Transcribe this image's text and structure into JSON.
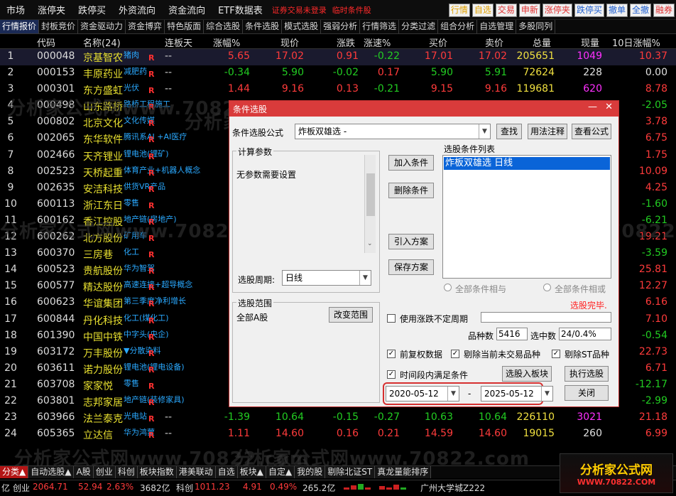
{
  "menu": {
    "items": [
      "市场",
      "涨停夹",
      "跌停买",
      "外资流向",
      "资金流向",
      "ETF数据表"
    ],
    "red_items": [
      "证券交易未登录",
      "临时条件股"
    ],
    "right_buttons": [
      {
        "label": "行情",
        "color": "#e0a000"
      },
      {
        "label": "自选",
        "color": "#e0a000"
      },
      {
        "label": "交易",
        "color": "#e03030"
      },
      {
        "label": "申新",
        "color": "#e03030"
      },
      {
        "label": "涨停夹",
        "color": "#e03030"
      },
      {
        "label": "跌停买",
        "color": "#2060d0"
      },
      {
        "label": "撤单",
        "color": "#2060d0"
      },
      {
        "label": "全撤",
        "color": "#2060d0"
      },
      {
        "label": "融券",
        "color": "#e03030"
      }
    ]
  },
  "tabs": [
    "行情报价",
    "封板竞价",
    "资金驱动力",
    "资金博弈",
    "特色版面",
    "综合选股",
    "条件选股",
    "模式选股",
    "强弱分析",
    "行情筛选",
    "分类过滤",
    "组合分析",
    "自选管理",
    "多股同列"
  ],
  "headers": {
    "idx": "",
    "code": "代码",
    "name": "名称(24)",
    "lbd": "连板天",
    "zdf": "涨幅%",
    "price": "现价",
    "zd": "涨跌",
    "zs": "涨速%",
    "buy": "买价",
    "sell": "卖价",
    "vol": "总量",
    "now": "现量",
    "zf10": "10日涨幅%"
  },
  "rows": [
    {
      "idx": "1",
      "code": "000048",
      "name": "京基智农",
      "tag": "猪肉",
      "lbd": "--",
      "zdf": "5.65",
      "price": "17.02",
      "zd": "0.91",
      "zs": "-0.22",
      "buy": "17.01",
      "sell": "17.02",
      "vol": "205651",
      "now": "1049",
      "zf10": "10.37"
    },
    {
      "idx": "2",
      "code": "000153",
      "name": "丰原药业",
      "tag": "减肥药",
      "lbd": "--",
      "zdf": "-0.34",
      "price": "5.90",
      "zd": "-0.02",
      "zs": "0.17",
      "buy": "5.90",
      "sell": "5.91",
      "vol": "72624",
      "now": "228",
      "zf10": "0.00"
    },
    {
      "idx": "3",
      "code": "000301",
      "name": "东方盛虹",
      "tag": "光伏",
      "lbd": "--",
      "zdf": "1.44",
      "price": "9.16",
      "zd": "0.13",
      "zs": "-0.21",
      "buy": "9.15",
      "sell": "9.16",
      "vol": "119681",
      "now": "620",
      "zf10": "8.78"
    },
    {
      "idx": "4",
      "code": "000498",
      "name": "山东路桥",
      "tag": "路桥工程施工",
      "lbd": "",
      "zdf": "",
      "price": "",
      "zd": "",
      "zs": "",
      "buy": "",
      "sell": "",
      "vol": "",
      "now": "",
      "zf10": "-2.05"
    },
    {
      "idx": "5",
      "code": "000802",
      "name": "北京文化",
      "tag": "文化传媒",
      "lbd": "",
      "zdf": "",
      "price": "",
      "zd": "",
      "zs": "",
      "buy": "",
      "sell": "",
      "vol": "",
      "now": "",
      "zf10": "3.78"
    },
    {
      "idx": "6",
      "code": "002065",
      "name": "东华软件",
      "tag": "腾讯系AI +AI医疗",
      "lbd": "",
      "zdf": "",
      "price": "",
      "zd": "",
      "zs": "",
      "buy": "",
      "sell": "",
      "vol": "",
      "now": "",
      "zf10": "6.75"
    },
    {
      "idx": "7",
      "code": "002466",
      "name": "天齐锂业",
      "tag": "锂电池(锂矿)",
      "lbd": "",
      "zdf": "",
      "price": "",
      "zd": "",
      "zs": "",
      "buy": "",
      "sell": "",
      "vol": "",
      "now": "",
      "zf10": "1.75"
    },
    {
      "idx": "8",
      "code": "002523",
      "name": "天桥起重",
      "tag": "体育产业+机器人概念",
      "lbd": "",
      "zdf": "",
      "price": "",
      "zd": "",
      "zs": "",
      "buy": "",
      "sell": "",
      "vol": "",
      "now": "",
      "zf10": "10.09"
    },
    {
      "idx": "9",
      "code": "002635",
      "name": "安洁科技",
      "tag": "供货VR产品",
      "lbd": "",
      "zdf": "",
      "price": "",
      "zd": "",
      "zs": "",
      "buy": "",
      "sell": "",
      "vol": "",
      "now": "",
      "zf10": "4.25"
    },
    {
      "idx": "10",
      "code": "600113",
      "name": "浙江东日",
      "tag": "零售",
      "lbd": "",
      "zdf": "",
      "price": "",
      "zd": "",
      "zs": "",
      "buy": "",
      "sell": "",
      "vol": "",
      "now": "",
      "zf10": "-1.60"
    },
    {
      "idx": "11",
      "code": "600162",
      "name": "香江控股",
      "tag": "地产链(房地产)",
      "lbd": "",
      "zdf": "",
      "price": "",
      "zd": "",
      "zs": "",
      "buy": "",
      "sell": "",
      "vol": "",
      "now": "",
      "zf10": "-6.21"
    },
    {
      "idx": "12",
      "code": "600262",
      "name": "北方股份",
      "tag": "矿用车",
      "lbd": "",
      "zdf": "",
      "price": "",
      "zd": "",
      "zs": "",
      "buy": "",
      "sell": "",
      "vol": "",
      "now": "",
      "zf10": "19.21"
    },
    {
      "idx": "13",
      "code": "600370",
      "name": "三房巷",
      "tag": "化工",
      "lbd": "",
      "zdf": "",
      "price": "",
      "zd": "",
      "zs": "",
      "buy": "",
      "sell": "",
      "vol": "",
      "now": "",
      "zf10": "-3.59"
    },
    {
      "idx": "14",
      "code": "600523",
      "name": "贵航股份",
      "tag": "华为智驾",
      "lbd": "",
      "zdf": "",
      "price": "",
      "zd": "",
      "zs": "",
      "buy": "",
      "sell": "",
      "vol": "",
      "now": "",
      "zf10": "25.81"
    },
    {
      "idx": "15",
      "code": "600577",
      "name": "精达股份",
      "tag": "高速连接+超导概念",
      "lbd": "",
      "zdf": "",
      "price": "",
      "zd": "",
      "zs": "",
      "buy": "",
      "sell": "",
      "vol": "",
      "now": "",
      "zf10": "12.27"
    },
    {
      "idx": "16",
      "code": "600623",
      "name": "华谊集团",
      "tag": "第三季度净利增长",
      "lbd": "",
      "zdf": "",
      "price": "",
      "zd": "",
      "zs": "",
      "buy": "",
      "sell": "",
      "vol": "",
      "now": "",
      "zf10": "6.16"
    },
    {
      "idx": "17",
      "code": "600844",
      "name": "丹化科技",
      "tag": "化工(煤化工)",
      "lbd": "",
      "zdf": "",
      "price": "",
      "zd": "",
      "zs": "",
      "buy": "",
      "sell": "",
      "vol": "",
      "now": "",
      "zf10": "7.10"
    },
    {
      "idx": "18",
      "code": "601390",
      "name": "中国中铁",
      "tag": "中字头(央企)",
      "lbd": "",
      "zdf": "",
      "price": "",
      "zd": "",
      "zs": "",
      "buy": "",
      "sell": "",
      "vol": "",
      "now": "",
      "zf10": "-0.54"
    },
    {
      "idx": "19",
      "code": "603172",
      "name": "万丰股份",
      "tag": "▼分散染料",
      "lbd": "",
      "zdf": "",
      "price": "",
      "zd": "",
      "zs": "",
      "buy": "",
      "sell": "",
      "vol": "",
      "now": "",
      "zf10": "22.73"
    },
    {
      "idx": "20",
      "code": "603611",
      "name": "诺力股份",
      "tag": "锂电池(锂电设备)",
      "lbd": "",
      "zdf": "",
      "price": "",
      "zd": "",
      "zs": "",
      "buy": "",
      "sell": "",
      "vol": "",
      "now": "",
      "zf10": "6.71"
    },
    {
      "idx": "21",
      "code": "603708",
      "name": "家家悦",
      "tag": "零售",
      "lbd": "",
      "zdf": "",
      "price": "",
      "zd": "",
      "zs": "",
      "buy": "",
      "sell": "",
      "vol": "",
      "now": "",
      "zf10": "-12.17"
    },
    {
      "idx": "22",
      "code": "603801",
      "name": "志邦家居",
      "tag": "地产链(装修家具)",
      "lbd": "",
      "zdf": "",
      "price": "",
      "zd": "",
      "zs": "",
      "buy": "",
      "sell": "",
      "vol": "",
      "now": "",
      "zf10": "-2.99"
    },
    {
      "idx": "23",
      "code": "603966",
      "name": "法兰泰克",
      "tag": "光电站",
      "lbd": "--",
      "zdf": "-1.39",
      "price": "10.64",
      "zd": "-0.15",
      "zs": "-0.27",
      "buy": "10.63",
      "sell": "10.64",
      "vol": "226110",
      "now": "3021",
      "zf10": "21.18"
    },
    {
      "idx": "24",
      "code": "605365",
      "name": "立达信",
      "tag": "华为鸿蒙",
      "lbd": "--",
      "zdf": "1.11",
      "price": "14.60",
      "zd": "0.16",
      "zs": "0.21",
      "buy": "14.59",
      "sell": "14.60",
      "vol": "19015",
      "now": "260",
      "zf10": "6.99"
    }
  ],
  "watermark": "分析家公式网www.70822.com",
  "bottom_tabs": [
    "分类▲",
    "自动选股▲",
    "A股",
    "创业",
    "科创",
    "板块指数",
    "港美联动",
    "自选",
    "板块▲",
    "自定▲",
    "我的股",
    "剔除北证ST",
    "真龙量能排序"
  ],
  "status": {
    "s1": "亿",
    "s2": "创业",
    "s3": "2064.71",
    "s4": "52.94",
    "s5": "2.63%",
    "s6": "3682亿",
    "s7": "科创",
    "s8": "1011.23",
    "s9": "4.91",
    "s10": "0.49%",
    "s11": "265.2亿",
    "s12": "广州大学城Z222"
  },
  "logo": {
    "line1": "分析家公式网",
    "line2": "WWW.70822.COM"
  },
  "dialog": {
    "title": "条件选股",
    "formula_label": "条件选股公式",
    "formula_value": "炸板双雄选  -",
    "btn_find": "查找",
    "btn_usage": "用法注释",
    "btn_view": "查看公式",
    "params_group": "计算参数",
    "params_text": "无参数需要设置",
    "period_label": "选股周期:",
    "period_value": "日线",
    "btn_add": "加入条件",
    "btn_del": "删除条件",
    "btn_import": "引入方案",
    "btn_save": "保存方案",
    "list_label": "选股条件列表",
    "list_item": "炸板双雄选  日线",
    "radio_and": "全部条件相与",
    "radio_or": "全部条件相或",
    "done": "选股完毕.",
    "range_group": "选股范围",
    "range_value": "全部A股",
    "btn_range": "改变范围",
    "chk_period": "使用涨跌不定周期",
    "count_label": "品种数",
    "count_value": "5416",
    "sel_label": "选中数",
    "sel_value": "24/0.4%",
    "chk_fq": "前复权数据",
    "chk_notrade": "剔除当前未交易品种",
    "chk_st": "剔除ST品种",
    "chk_interval": "时间段内满足条件",
    "btn_toblock": "选股入板块",
    "btn_exec": "执行选股",
    "date_from": "2020-05-12",
    "date_sep": "-",
    "date_to": "2025-05-12",
    "btn_close": "关闭"
  }
}
